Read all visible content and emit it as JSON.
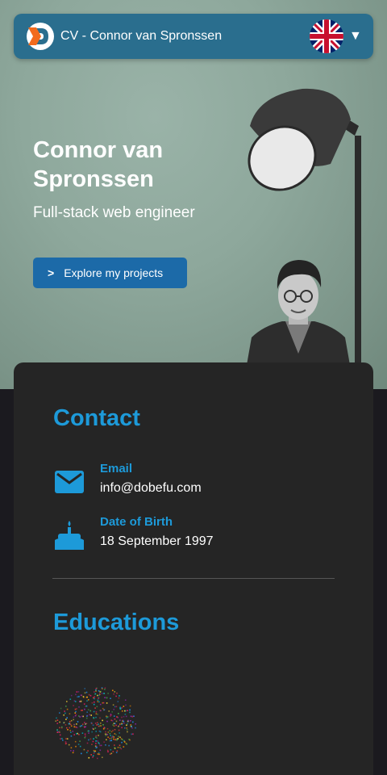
{
  "header": {
    "title": "CV - Connor van Spronssen",
    "dropdown_symbol": "▼",
    "language_flag": "uk-flag-icon",
    "brand_color": "#2a6e8e"
  },
  "hero": {
    "name": "Connor van Spronssen",
    "subtitle": "Full-stack web engineer",
    "cta_label": "Explore my projects",
    "cta_icon": "chevron-right-icon",
    "cta_color": "#1c6aa8"
  },
  "contact": {
    "title": "Contact",
    "email_label": "Email",
    "email_value": "info@dobefu.com",
    "dob_label": "Date of Birth",
    "dob_value": "18 September 1997",
    "accent": "#1d9ad9"
  },
  "educations": {
    "title": "Educations"
  }
}
